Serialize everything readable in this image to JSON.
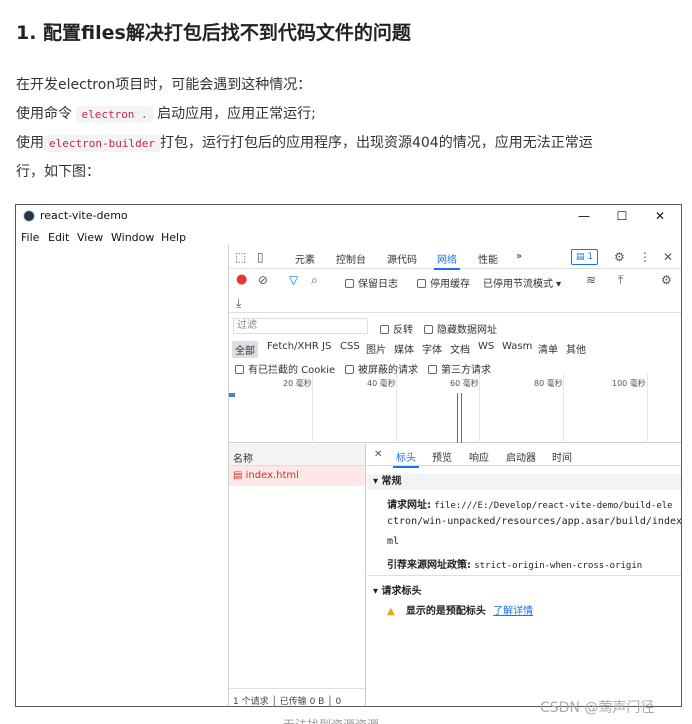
{
  "article": {
    "heading": "1. 配置files解决打包后找不到代码文件的问题",
    "p1": "在开发electron项目时，可能会遇到这种情况：",
    "p2_before": "使用命令",
    "p2_code": "electron .",
    "p2_after": "启动应用，应用正常运行;",
    "p3_before": "使用",
    "p3_code": "electron-builder",
    "p3_after": "打包，运行打包后的应用程序，出现资源404的情况，应用无法正常运",
    "p4": "行，如下图：",
    "caption": "无法找到资源资源",
    "watermark": "CSDN @莺声门径"
  },
  "window": {
    "title": "react-vite-demo",
    "minimize": "—",
    "maximize": "☐",
    "close": "✕",
    "menu": [
      "File",
      "Edit",
      "View",
      "Window",
      "Help"
    ]
  },
  "devtools": {
    "tabs": [
      "元素",
      "控制台",
      "源代码",
      "网络",
      "性能"
    ],
    "more": "»",
    "badge": "1",
    "toolbar": {
      "preserve_log": "保留日志",
      "disable_cache": "停用缓存",
      "throttle": "已停用节流模式"
    },
    "filter": {
      "placeholder": "过滤",
      "invert": "反转",
      "hide_data_urls": "隐藏数据网址",
      "types": [
        "全部",
        "Fetch/XHR",
        "JS",
        "CSS",
        "图片",
        "媒体",
        "字体",
        "文档",
        "WS",
        "Wasm",
        "清单",
        "其他"
      ],
      "blocked_cookies": "有已拦截的 Cookie",
      "blocked_requests": "被屏蔽的请求",
      "third_party": "第三方请求"
    },
    "timeline_ticks": [
      "20 毫秒",
      "40 毫秒",
      "60 毫秒",
      "80 毫秒",
      "100 毫秒"
    ],
    "requests": {
      "name_header": "名称",
      "items": [
        "index.html"
      ],
      "status_count": "1 个请求",
      "status_transferred": "已传输 0 B",
      "status_extra": "0"
    },
    "detail": {
      "tabs": [
        "标头",
        "预览",
        "响应",
        "启动器",
        "时间"
      ],
      "general": "常规",
      "request_url_label": "请求网址:",
      "request_url_1": "file:///E:/Develop/react-vite-demo/build-ele",
      "request_url_2": "ctron/win-unpacked/resources/app.asar/build/index.ht",
      "request_url_3": "ml",
      "referrer_label": "引荐来源网址政策:",
      "referrer_value": "strict-origin-when-cross-origin",
      "request_headers": "请求标头",
      "warning_text": "显示的是预配标头",
      "learn_more": "了解详情"
    }
  }
}
